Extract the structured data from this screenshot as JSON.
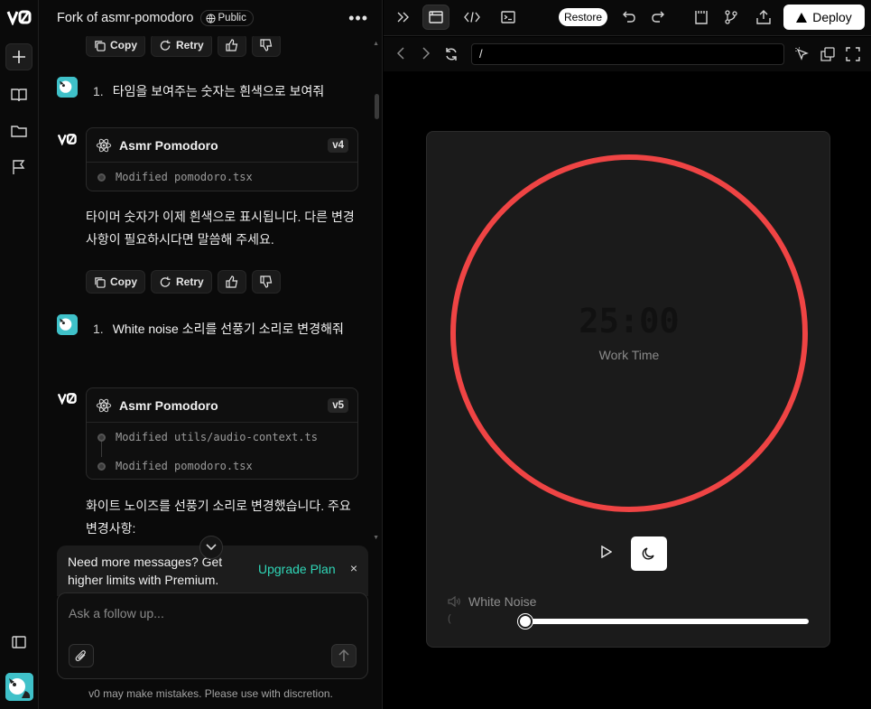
{
  "chat": {
    "title": "Fork of asmr-pomodoro",
    "visibility": "Public",
    "actions": {
      "copy": "Copy",
      "retry": "Retry"
    },
    "messages": [
      {
        "role": "user",
        "number": "1.",
        "text": "타임을 보여주는 숫자는 흰색으로 보여줘"
      },
      {
        "role": "assistant",
        "card_title": "Asmr Pomodoro",
        "version": "v4",
        "files": [
          "Modified pomodoro.tsx"
        ],
        "text": "타이머 숫자가 이제 흰색으로 표시됩니다. 다른 변경사항이 필요하시다면 말씀해 주세요."
      },
      {
        "role": "user",
        "number": "1.",
        "text": "White noise 소리를 선풍기 소리로 변경해줘"
      },
      {
        "role": "assistant",
        "card_title": "Asmr Pomodoro",
        "version": "v5",
        "files": [
          "Modified utils/audio-context.ts",
          "Modified pomodoro.tsx"
        ],
        "text": "화이트 노이즈를 선풍기 소리로 변경했습니다. 주요 변경사항:"
      }
    ],
    "upsell": {
      "text": "Need more messages? Get higher limits with Premium.",
      "cta": "Upgrade Plan",
      "close": "×"
    },
    "composer": {
      "placeholder": "Ask a follow up..."
    },
    "disclaimer": "v0 may make mistakes. Please use with discretion."
  },
  "preview": {
    "toolbar": {
      "restore": "Restore",
      "deploy": "Deploy"
    },
    "url": "/",
    "app": {
      "time": "25:00",
      "mode": "Work Time",
      "noise_label": "White Noise",
      "volume": 0.03,
      "ring_color": "#ef4444"
    }
  },
  "colors": {
    "accent": "#2fd6b7",
    "ring": "#ef4444",
    "background": "#000000"
  }
}
